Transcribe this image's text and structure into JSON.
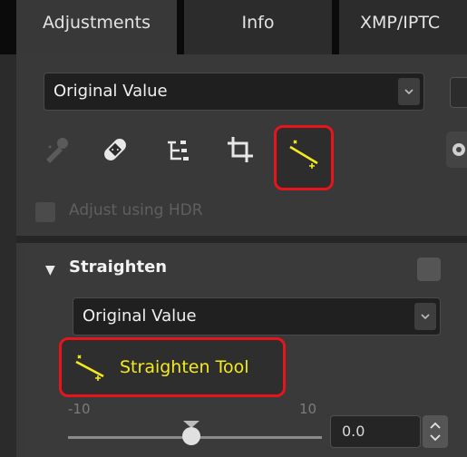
{
  "tabs": [
    {
      "label": "Adjustments",
      "active": true
    },
    {
      "label": "Info",
      "active": false
    },
    {
      "label": "XMP/IPTC",
      "active": false
    }
  ],
  "preset_select": {
    "value": "Original Value"
  },
  "tools": [
    "retouch-brush-icon",
    "bandage-icon",
    "levels-tree-icon",
    "crop-icon",
    "straighten-icon"
  ],
  "hdr": {
    "label": "Adjust using HDR",
    "checked": false
  },
  "straighten": {
    "title": "Straighten",
    "select_value": "Original Value",
    "tool_label": "Straighten Tool",
    "slider": {
      "min_label": "-10",
      "max_label": "10",
      "value": 0.0
    },
    "value_text": "0.0"
  },
  "colors": {
    "highlight": "#e8141c",
    "tool_yellow": "#f5ea1b",
    "panel": "#393939"
  }
}
